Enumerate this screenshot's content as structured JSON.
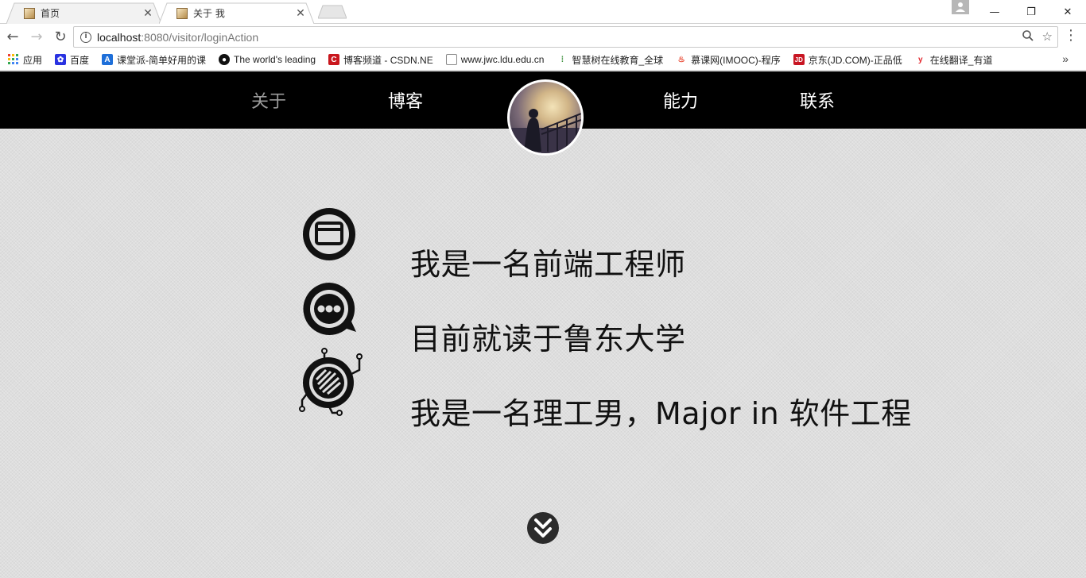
{
  "browser": {
    "tabs": [
      {
        "title": "首页"
      },
      {
        "title": "关于 我"
      }
    ],
    "url_host": "localhost",
    "url_path": ":8080/visitor/loginAction",
    "bookmarks": [
      {
        "label": "应用",
        "icon": "apps-grid-icon"
      },
      {
        "label": "百度",
        "icon": "baidu-icon"
      },
      {
        "label": "课堂派-简单好用的课",
        "icon": "ketangpai-icon"
      },
      {
        "label": "The world's leading",
        "icon": "github-icon"
      },
      {
        "label": "博客频道 - CSDN.NE",
        "icon": "csdn-icon"
      },
      {
        "label": "www.jwc.ldu.edu.cn",
        "icon": "page-icon"
      },
      {
        "label": "智慧树在线教育_全球",
        "icon": "zhihuishu-icon"
      },
      {
        "label": "慕课网(IMOOC)-程序",
        "icon": "imooc-icon"
      },
      {
        "label": "京东(JD.COM)-正品低",
        "icon": "jd-icon"
      },
      {
        "label": "在线翻译_有道",
        "icon": "youdao-icon"
      }
    ]
  },
  "nav": {
    "items": [
      {
        "label": "关于",
        "active": true
      },
      {
        "label": "博客",
        "active": false
      },
      {
        "label": "能力",
        "active": false
      },
      {
        "label": "联系",
        "active": false
      }
    ]
  },
  "about": {
    "lines": [
      {
        "text": "我是一名前端工程师",
        "icon": "browser-window-icon"
      },
      {
        "text": "目前就读于鲁东大学",
        "icon": "chat-bubble-icon"
      },
      {
        "text": "我是一名理工男，Major in 软件工程",
        "icon": "circuit-chip-icon"
      }
    ]
  },
  "colors": {
    "nav_bg": "#000000",
    "nav_text": "#ffffff",
    "nav_active": "#9a9a9a",
    "content_bg": "#dedede",
    "text": "#111111"
  }
}
